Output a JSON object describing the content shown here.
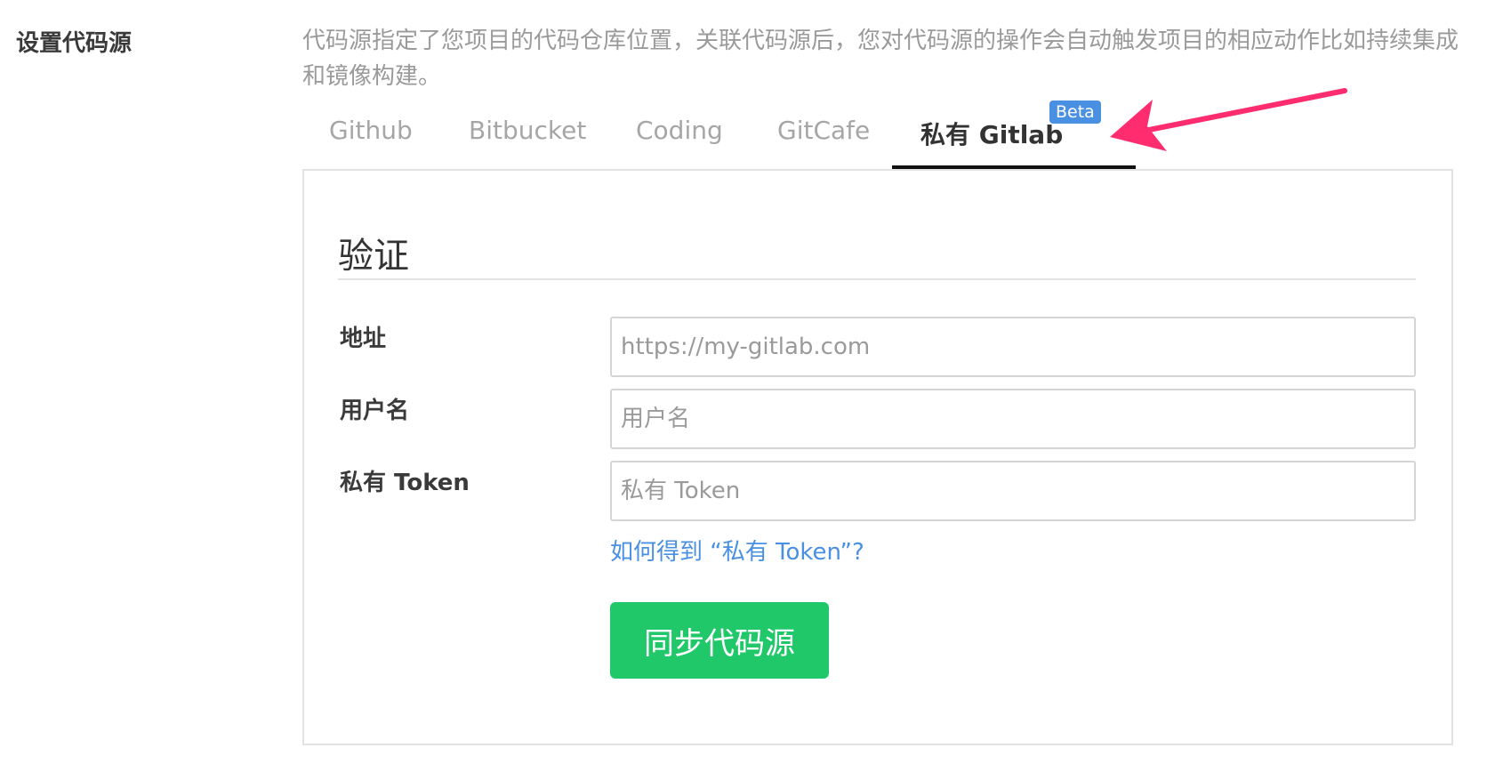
{
  "section": {
    "title": "设置代码源",
    "description": "代码源指定了您项目的代码仓库位置，关联代码源后，您对代码源的操作会自动触发项目的相应动作比如持续集成和镜像构建。"
  },
  "tabs": [
    {
      "label": "Github"
    },
    {
      "label": "Bitbucket"
    },
    {
      "label": "Coding"
    },
    {
      "label": "GitCafe"
    },
    {
      "label": "私有 Gitlab",
      "active": true,
      "badge": "Beta"
    }
  ],
  "form": {
    "heading": "验证",
    "fields": [
      {
        "label": "地址",
        "placeholder": "https://my-gitlab.com",
        "value": ""
      },
      {
        "label": "用户名",
        "placeholder": "用户名",
        "value": ""
      },
      {
        "label": "私有 Token",
        "placeholder": "私有 Token",
        "value": ""
      }
    ],
    "help_link": "如何得到 “私有 Token”?",
    "submit_label": "同步代码源"
  },
  "colors": {
    "accent_green": "#21c86a",
    "link_blue": "#4a90e2",
    "annotation_arrow": "#ff2d6f"
  }
}
